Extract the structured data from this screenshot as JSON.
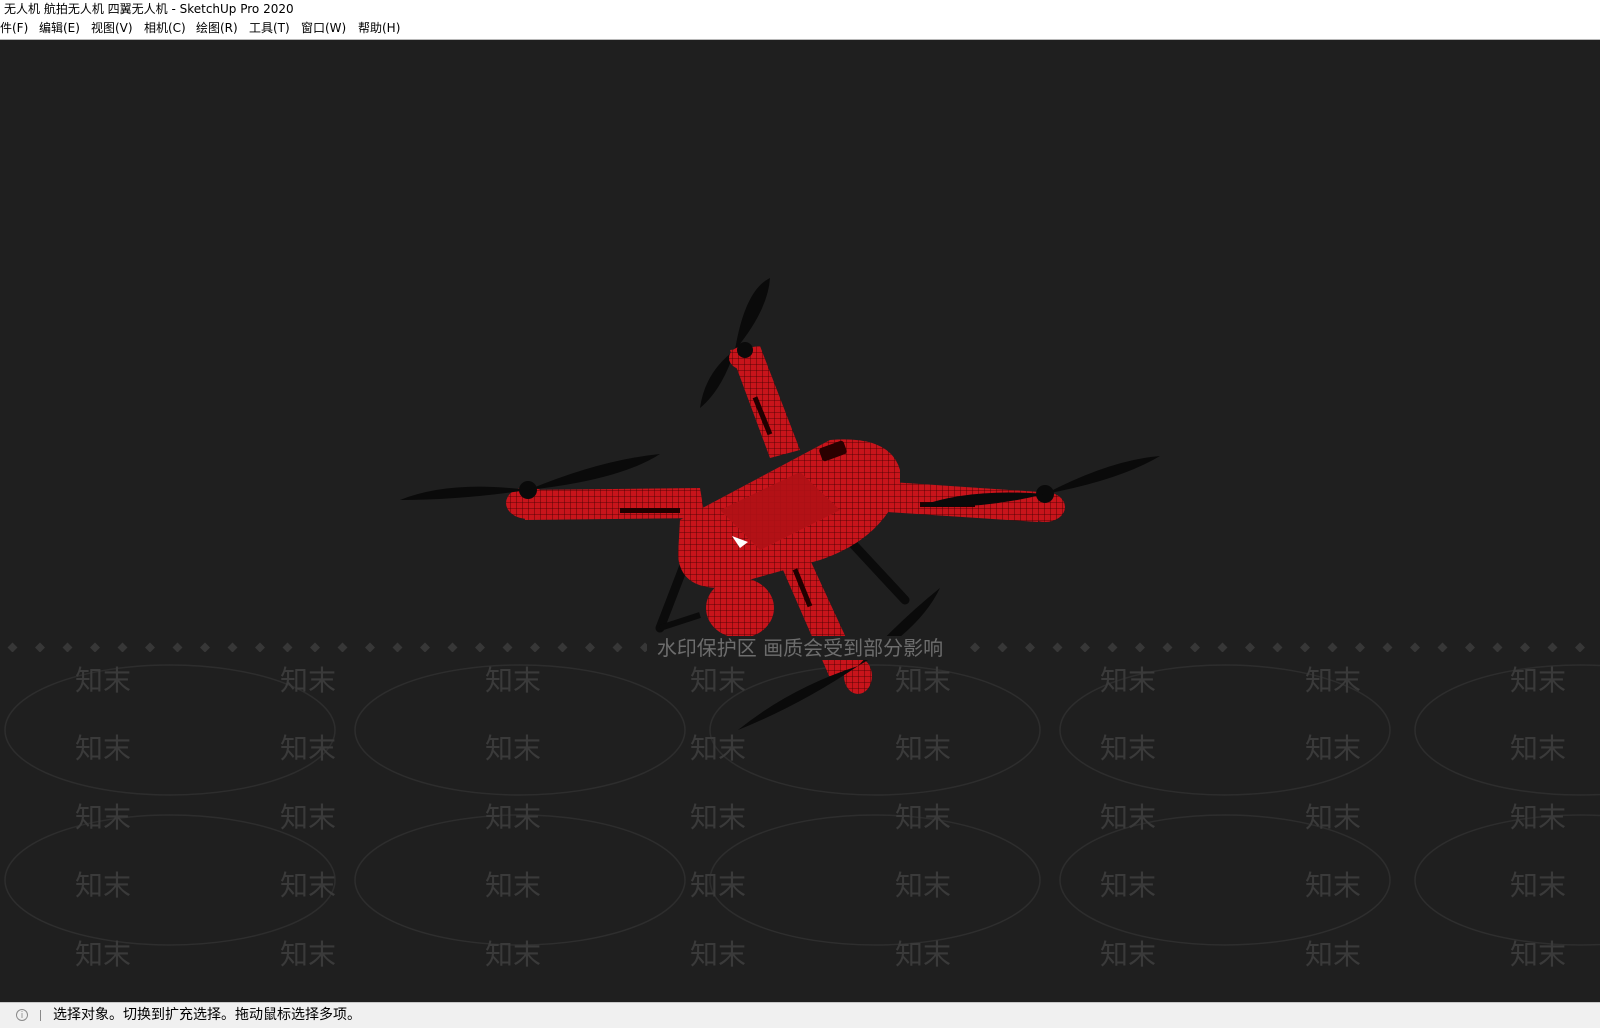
{
  "window": {
    "title": "无人机 航拍无人机 四翼无人机 - SketchUp Pro 2020"
  },
  "menubar": {
    "items": [
      {
        "label": "件(F)"
      },
      {
        "label": "编辑(E)"
      },
      {
        "label": "视图(V)"
      },
      {
        "label": "相机(C)"
      },
      {
        "label": "绘图(R)"
      },
      {
        "label": "工具(T)"
      },
      {
        "label": "窗口(W)"
      },
      {
        "label": "帮助(H)"
      }
    ]
  },
  "viewport": {
    "background": "#1f1f1f",
    "model_color": "#c8141b",
    "watermark_notice": "水印保护区   画质会受到部分影响",
    "watermark_logo": "知末"
  },
  "statusbar": {
    "icon": "info-icon",
    "text": "选择对象。切换到扩充选择。拖动鼠标选择多项。"
  }
}
